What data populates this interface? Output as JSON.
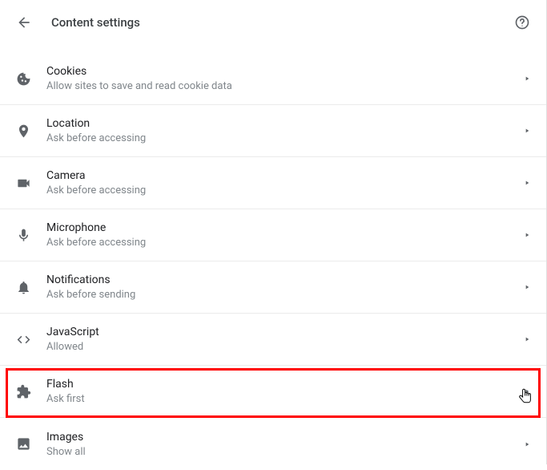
{
  "header": {
    "title": "Content settings"
  },
  "items": [
    {
      "icon": "cookie",
      "title": "Cookies",
      "subtitle": "Allow sites to save and read cookie data"
    },
    {
      "icon": "location",
      "title": "Location",
      "subtitle": "Ask before accessing"
    },
    {
      "icon": "camera",
      "title": "Camera",
      "subtitle": "Ask before accessing"
    },
    {
      "icon": "microphone",
      "title": "Microphone",
      "subtitle": "Ask before accessing"
    },
    {
      "icon": "notifications",
      "title": "Notifications",
      "subtitle": "Ask before sending"
    },
    {
      "icon": "javascript",
      "title": "JavaScript",
      "subtitle": "Allowed"
    },
    {
      "icon": "flash",
      "title": "Flash",
      "subtitle": "Ask first"
    },
    {
      "icon": "images",
      "title": "Images",
      "subtitle": "Show all"
    }
  ]
}
